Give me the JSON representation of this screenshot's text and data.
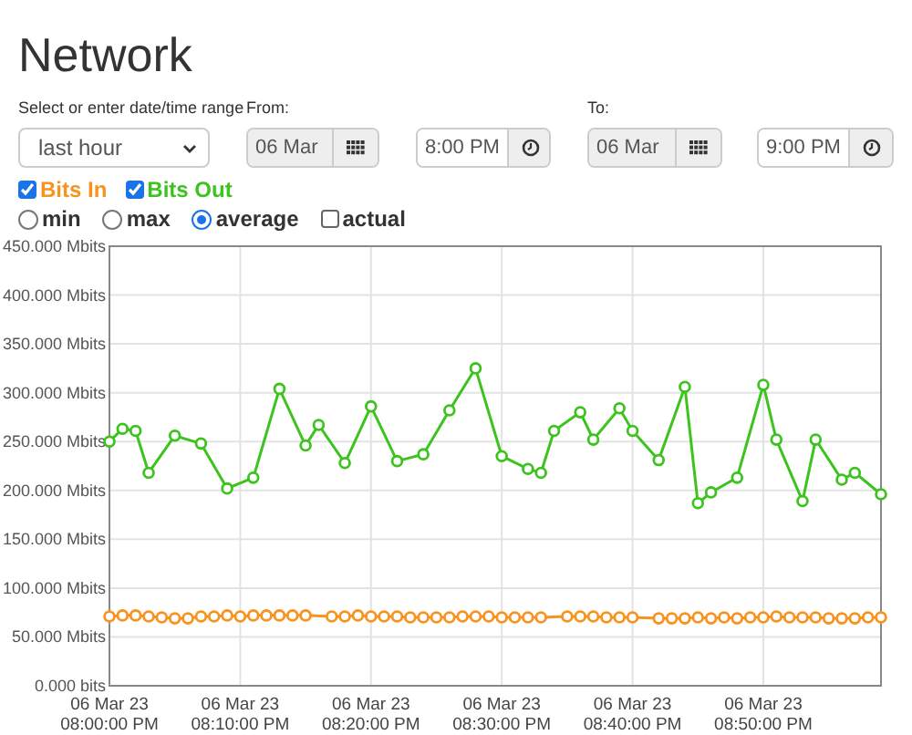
{
  "title": "Network",
  "range": {
    "label": "Select or enter date/time range",
    "value": "last hour"
  },
  "from": {
    "label": "From:",
    "date": "06 Mar",
    "date_disabled": true,
    "time": "8:00 PM"
  },
  "to": {
    "label": "To:",
    "date": "06 Mar",
    "date_disabled": true,
    "time": "9:00 PM"
  },
  "series_toggles": [
    {
      "checked": true
    },
    {
      "checked": true
    }
  ],
  "modes": [
    {
      "label": "min",
      "kind": "radio",
      "selected": false
    },
    {
      "label": "max",
      "kind": "radio",
      "selected": false
    },
    {
      "label": "average",
      "kind": "radio",
      "selected": true
    },
    {
      "label": "actual",
      "kind": "checkbox",
      "selected": false
    }
  ],
  "chart_data": {
    "type": "line",
    "categories": [
      "06 Mar 23 08:00:00 PM",
      null,
      null,
      null,
      null,
      null,
      null,
      null,
      null,
      null,
      "06 Mar 23 08:10:00 PM",
      null,
      null,
      null,
      null,
      null,
      null,
      null,
      null,
      null,
      "06 Mar 23 08:20:00 PM",
      null,
      null,
      null,
      null,
      null,
      null,
      null,
      null,
      null,
      "06 Mar 23 08:30:00 PM",
      null,
      null,
      null,
      null,
      null,
      null,
      null,
      null,
      null,
      "06 Mar 23 08:40:00 PM",
      null,
      null,
      null,
      null,
      null,
      null,
      null,
      null,
      null,
      "06 Mar 23 08:50:00 PM",
      null,
      null,
      null,
      null,
      null,
      null,
      null,
      null,
      null
    ],
    "ylim": [
      0,
      450
    ],
    "grid": true,
    "yticks": [
      {
        "value": 0,
        "label": "0.000 bits"
      },
      {
        "value": 50,
        "label": "50.000 Mbits"
      },
      {
        "value": 100,
        "label": "100.000 Mbits"
      },
      {
        "value": 150,
        "label": "150.000 Mbits"
      },
      {
        "value": 200,
        "label": "200.000 Mbits"
      },
      {
        "value": 250,
        "label": "250.000 Mbits"
      },
      {
        "value": 300,
        "label": "300.000 Mbits"
      },
      {
        "value": 350,
        "label": "350.000 Mbits"
      },
      {
        "value": 400,
        "label": "400.000 Mbits"
      },
      {
        "value": 450,
        "label": "450.000 Mbits"
      }
    ],
    "series": [
      {
        "name": "Bits In",
        "color": "#f7931e",
        "marker": "circle",
        "values": [
          71,
          72,
          72,
          71,
          70,
          69,
          69,
          71,
          71,
          72,
          71,
          72,
          72,
          72,
          72,
          72,
          null,
          71,
          71,
          72,
          71,
          71,
          71,
          70,
          70,
          70,
          70,
          71,
          71,
          71,
          70,
          70,
          70,
          70,
          null,
          71,
          71,
          71,
          70,
          70,
          70,
          null,
          69,
          69,
          69,
          70,
          69,
          70,
          69,
          70,
          70,
          71,
          70,
          70,
          70,
          69,
          69,
          69,
          70,
          70
        ]
      },
      {
        "name": "Bits Out",
        "color": "#3cc31e",
        "marker": "circle",
        "values": [
          250,
          263,
          261,
          218,
          null,
          256,
          null,
          248,
          null,
          202,
          null,
          213,
          null,
          304,
          null,
          246,
          267,
          null,
          228,
          null,
          286,
          null,
          230,
          null,
          237,
          null,
          282,
          null,
          325,
          null,
          235,
          null,
          222,
          218,
          261,
          null,
          280,
          252,
          null,
          284,
          261,
          null,
          231,
          null,
          306,
          187,
          198,
          null,
          213,
          null,
          308,
          252,
          null,
          189,
          252,
          null,
          211,
          218,
          null,
          196
        ]
      }
    ]
  }
}
